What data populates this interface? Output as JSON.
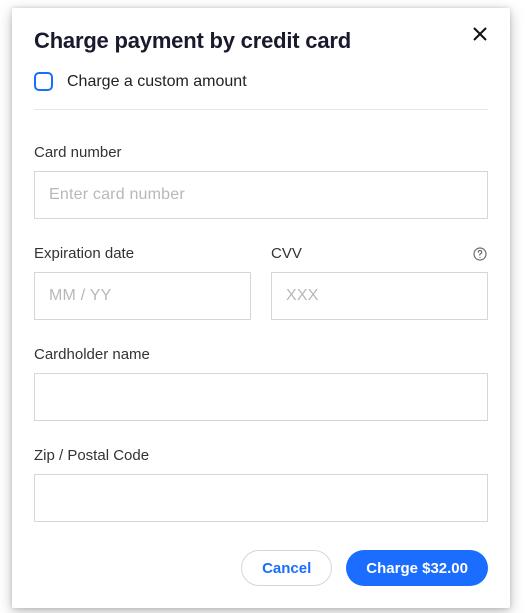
{
  "header": {
    "title": "Charge payment by credit card"
  },
  "custom_amount": {
    "checkbox_label": "Charge a custom amount"
  },
  "fields": {
    "card_number": {
      "label": "Card number",
      "placeholder": "Enter card number",
      "value": ""
    },
    "expiration": {
      "label": "Expiration date",
      "placeholder": "MM / YY",
      "value": ""
    },
    "cvv": {
      "label": "CVV",
      "placeholder": "XXX",
      "value": ""
    },
    "cardholder": {
      "label": "Cardholder name",
      "placeholder": "",
      "value": ""
    },
    "zip": {
      "label": "Zip / Postal Code",
      "placeholder": "",
      "value": ""
    }
  },
  "footer": {
    "cancel_label": "Cancel",
    "charge_label": "Charge $32.00"
  },
  "colors": {
    "accent": "#1a6dff",
    "border": "#d6d6d8",
    "placeholder": "#b8b8bb"
  }
}
